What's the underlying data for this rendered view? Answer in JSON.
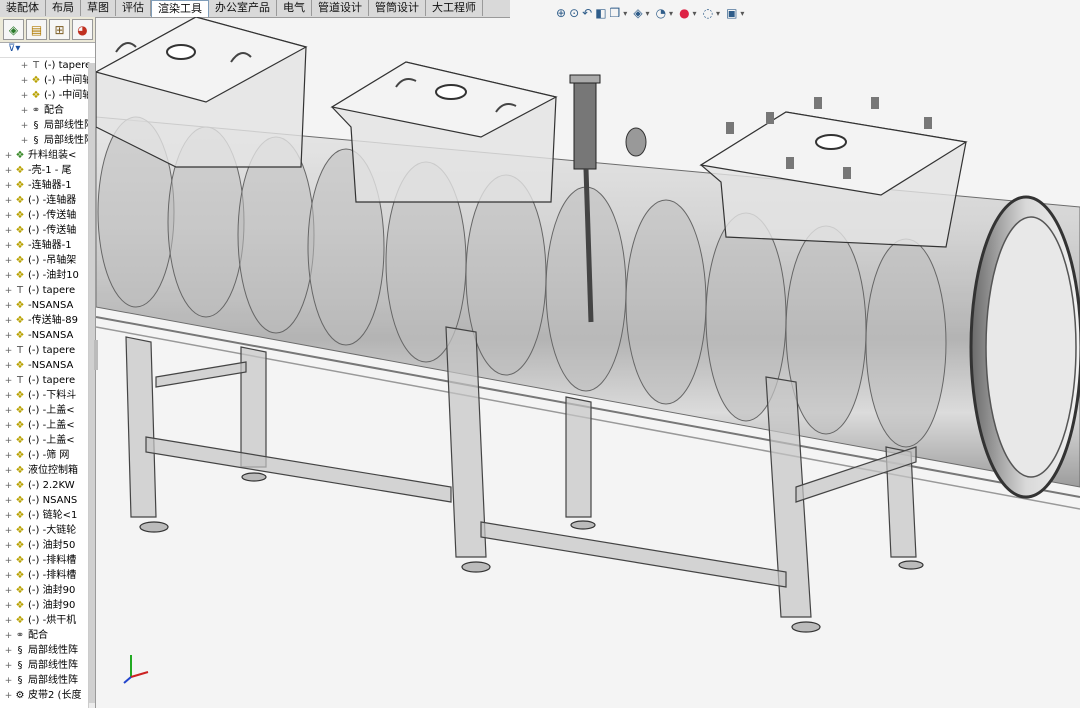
{
  "tabs": [
    {
      "label": "装配体",
      "active": false
    },
    {
      "label": "布局",
      "active": false
    },
    {
      "label": "草图",
      "active": false
    },
    {
      "label": "评估",
      "active": false
    },
    {
      "label": "渲染工具",
      "active": true
    },
    {
      "label": "办公室产品",
      "active": false
    },
    {
      "label": "电气",
      "active": false
    },
    {
      "label": "管道设计",
      "active": false
    },
    {
      "label": "管筒设计",
      "active": false
    },
    {
      "label": "大工程师",
      "active": false
    }
  ],
  "hud": [
    "zoom-to-fit",
    "zoom-to-area",
    "previous-view",
    "section-view",
    "view-orientation",
    "display-style",
    "hide-show",
    "edit-appearance",
    "apply-scene",
    "view-settings"
  ],
  "panel": {
    "tabs": [
      "feature-manager",
      "property-manager",
      "configuration-manager",
      "display-manager"
    ],
    "filter": "▾"
  },
  "tree": [
    {
      "label": "(-) tapere",
      "icon": "screw",
      "exp": "+",
      "indent": 20
    },
    {
      "label": "(-) -中间轴",
      "icon": "part",
      "exp": "+",
      "indent": 20
    },
    {
      "label": "(-) -中间轴",
      "icon": "part",
      "exp": "+",
      "indent": 20
    },
    {
      "label": "配合",
      "icon": "mate",
      "exp": "+",
      "indent": 20
    },
    {
      "label": "局部线性阵列",
      "icon": "pattern",
      "exp": "+",
      "indent": 20
    },
    {
      "label": "局部线性阵列",
      "icon": "pattern",
      "exp": "+",
      "indent": 20
    },
    {
      "label": "升料组装<",
      "icon": "asm",
      "exp": "+",
      "indent": 4
    },
    {
      "label": "-壳-1 - 尾",
      "icon": "part",
      "exp": "+",
      "indent": 4
    },
    {
      "label": "-连轴器-1",
      "icon": "part",
      "exp": "+",
      "indent": 4
    },
    {
      "label": "(-) -连轴器",
      "icon": "part",
      "exp": "+",
      "indent": 4
    },
    {
      "label": "(-) -传送轴",
      "icon": "part",
      "exp": "+",
      "indent": 4
    },
    {
      "label": "(-) -传送轴",
      "icon": "part",
      "exp": "+",
      "indent": 4
    },
    {
      "label": "-连轴器-1",
      "icon": "part",
      "exp": "+",
      "indent": 4
    },
    {
      "label": "(-) -吊轴架",
      "icon": "part",
      "exp": "+",
      "indent": 4
    },
    {
      "label": "(-) -油封10",
      "icon": "part",
      "exp": "+",
      "indent": 4
    },
    {
      "label": "(-) tapere",
      "icon": "screw",
      "exp": "+",
      "indent": 4
    },
    {
      "label": "-NSANSA",
      "icon": "part",
      "exp": "+",
      "indent": 4
    },
    {
      "label": "-传送轴-89",
      "icon": "part",
      "exp": "+",
      "indent": 4
    },
    {
      "label": "-NSANSA",
      "icon": "part",
      "exp": "+",
      "indent": 4
    },
    {
      "label": "(-) tapere",
      "icon": "screw",
      "exp": "+",
      "indent": 4
    },
    {
      "label": "-NSANSA",
      "icon": "part",
      "exp": "+",
      "indent": 4
    },
    {
      "label": "(-) tapere",
      "icon": "screw",
      "exp": "+",
      "indent": 4
    },
    {
      "label": "(-) -下料斗",
      "icon": "part",
      "exp": "+",
      "indent": 4
    },
    {
      "label": "(-) -上盖<",
      "icon": "part",
      "exp": "+",
      "indent": 4
    },
    {
      "label": "(-) -上盖<",
      "icon": "part",
      "exp": "+",
      "indent": 4
    },
    {
      "label": "(-) -上盖<",
      "icon": "part",
      "exp": "+",
      "indent": 4
    },
    {
      "label": "(-) -筛 网",
      "icon": "part",
      "exp": "+",
      "indent": 4
    },
    {
      "label": "液位控制箱",
      "icon": "part",
      "exp": "+",
      "indent": 4
    },
    {
      "label": "(-) 2.2KW",
      "icon": "part",
      "exp": "+",
      "indent": 4
    },
    {
      "label": "(-) NSANS",
      "icon": "part",
      "exp": "+",
      "indent": 4
    },
    {
      "label": "(-) 链轮<1",
      "icon": "part",
      "exp": "+",
      "indent": 4
    },
    {
      "label": "(-) -大链轮",
      "icon": "part",
      "exp": "+",
      "indent": 4
    },
    {
      "label": "(-) 油封50",
      "icon": "part",
      "exp": "+",
      "indent": 4
    },
    {
      "label": "(-) -排料槽",
      "icon": "part",
      "exp": "+",
      "indent": 4
    },
    {
      "label": "(-) -排料槽",
      "icon": "part",
      "exp": "+",
      "indent": 4
    },
    {
      "label": "(-) 油封90",
      "icon": "part",
      "exp": "+",
      "indent": 4
    },
    {
      "label": "(-) 油封90",
      "icon": "part",
      "exp": "+",
      "indent": 4
    },
    {
      "label": "(-) -烘干机",
      "icon": "part",
      "exp": "+",
      "indent": 4
    },
    {
      "label": "配合",
      "icon": "mate",
      "exp": "+",
      "indent": 4
    },
    {
      "label": "局部线性阵",
      "icon": "pattern",
      "exp": "+",
      "indent": 4
    },
    {
      "label": "局部线性阵",
      "icon": "pattern",
      "exp": "+",
      "indent": 4
    },
    {
      "label": "局部线性阵",
      "icon": "pattern",
      "exp": "+",
      "indent": 4
    },
    {
      "label": "皮带2 (长度",
      "icon": "belt",
      "exp": "+",
      "indent": 4
    }
  ],
  "model": {
    "tube_color": "#c8c8c8",
    "frame_color": "#9e9e9e",
    "hopper_color": "#d6d6d6",
    "triad": [
      "x-axis",
      "y-axis",
      "z-axis"
    ]
  }
}
